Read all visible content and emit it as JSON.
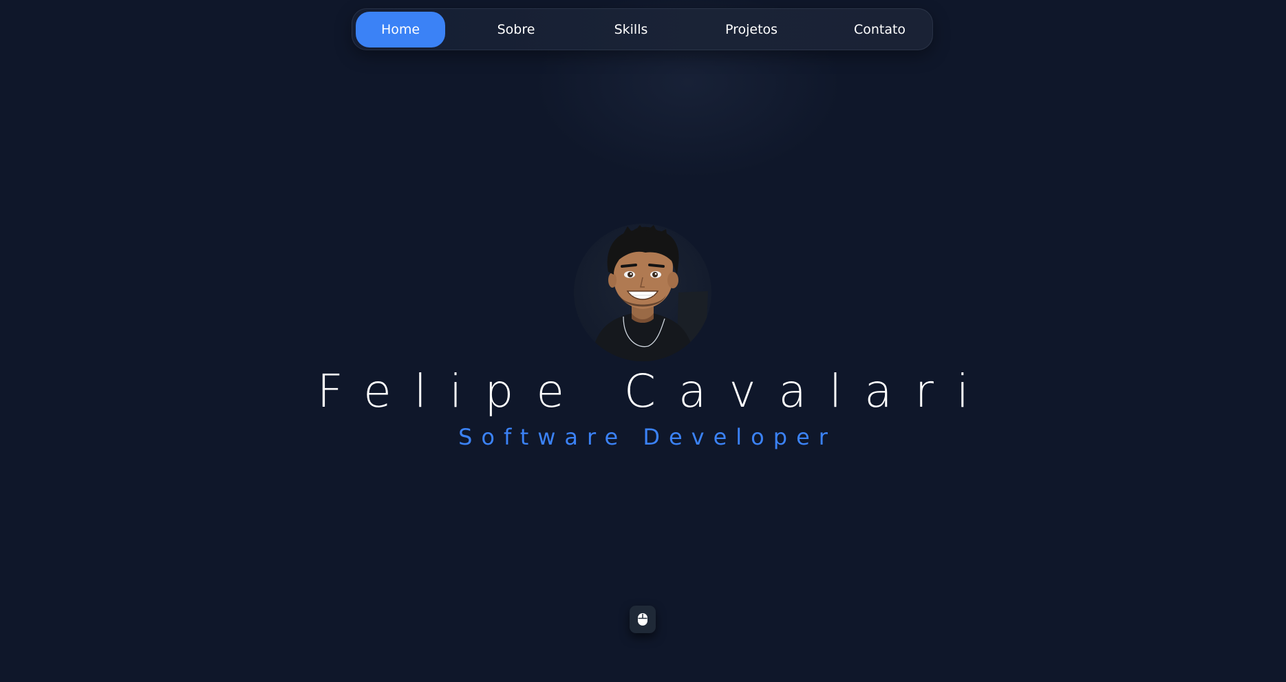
{
  "nav": {
    "items": [
      {
        "label": "Home",
        "active": true
      },
      {
        "label": "Sobre",
        "active": false
      },
      {
        "label": "Skills",
        "active": false
      },
      {
        "label": "Projetos",
        "active": false
      },
      {
        "label": "Contato",
        "active": false
      }
    ]
  },
  "hero": {
    "name": "Felipe Cavalari",
    "role": "Software Developer"
  },
  "icons": {
    "avatar": "cartoon-avatar-portrait",
    "scroll": "mouse-icon"
  },
  "colors": {
    "background": "#0f172a",
    "accent": "#3b82f6",
    "text": "#ffffff",
    "scroll_button": "#1f2937"
  }
}
